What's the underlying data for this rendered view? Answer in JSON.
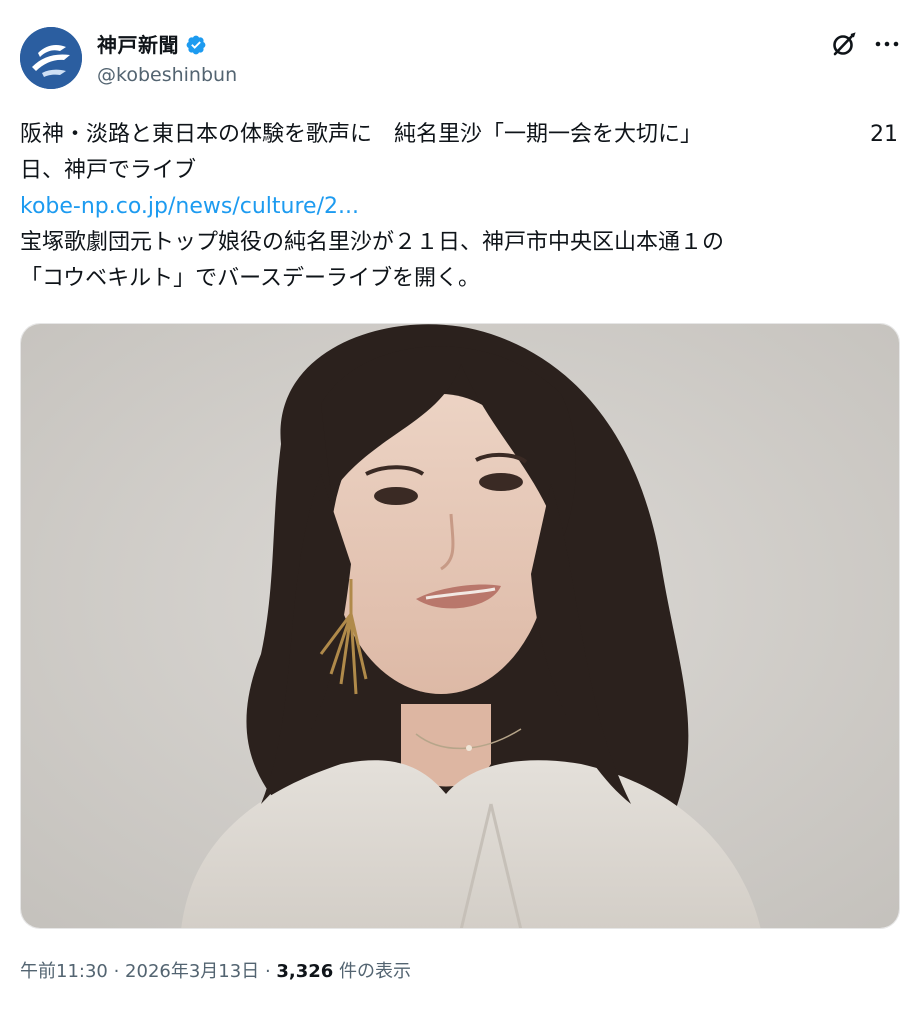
{
  "author": {
    "display_name": "神戸新聞",
    "handle": "@kobeshinbun",
    "verified_badge_color": "#1d9bf0",
    "avatar_color": "#2b5ea0"
  },
  "actions": {
    "grok_icon": "grok-icon",
    "more_icon": "more-icon"
  },
  "tweet": {
    "headline_line1": "阪神・淡路と東日本の体験を歌声に　純名里沙「一期一会を大切に」",
    "headline_line1_end": "21",
    "headline_line2": "日、神戸でライブ",
    "link_text": "kobe-np.co.jp/news/culture/2...",
    "body_line1": "宝塚歌劇団元トップ娘役の純名里沙が２１日、神戸市中央区山本通１の",
    "body_line2": "「コウベキルト」でバースデーライブを開く。"
  },
  "media": {
    "type": "photo",
    "subject": "portrait"
  },
  "meta": {
    "time": "午前11:30",
    "separator": " · ",
    "date": "2026年3月13日",
    "separator2": " · ",
    "views_count": "3,326",
    "views_label": " 件の表示"
  },
  "colors": {
    "link": "#1d9bf0",
    "secondary_text": "#536471",
    "primary_text": "#0f1419"
  }
}
